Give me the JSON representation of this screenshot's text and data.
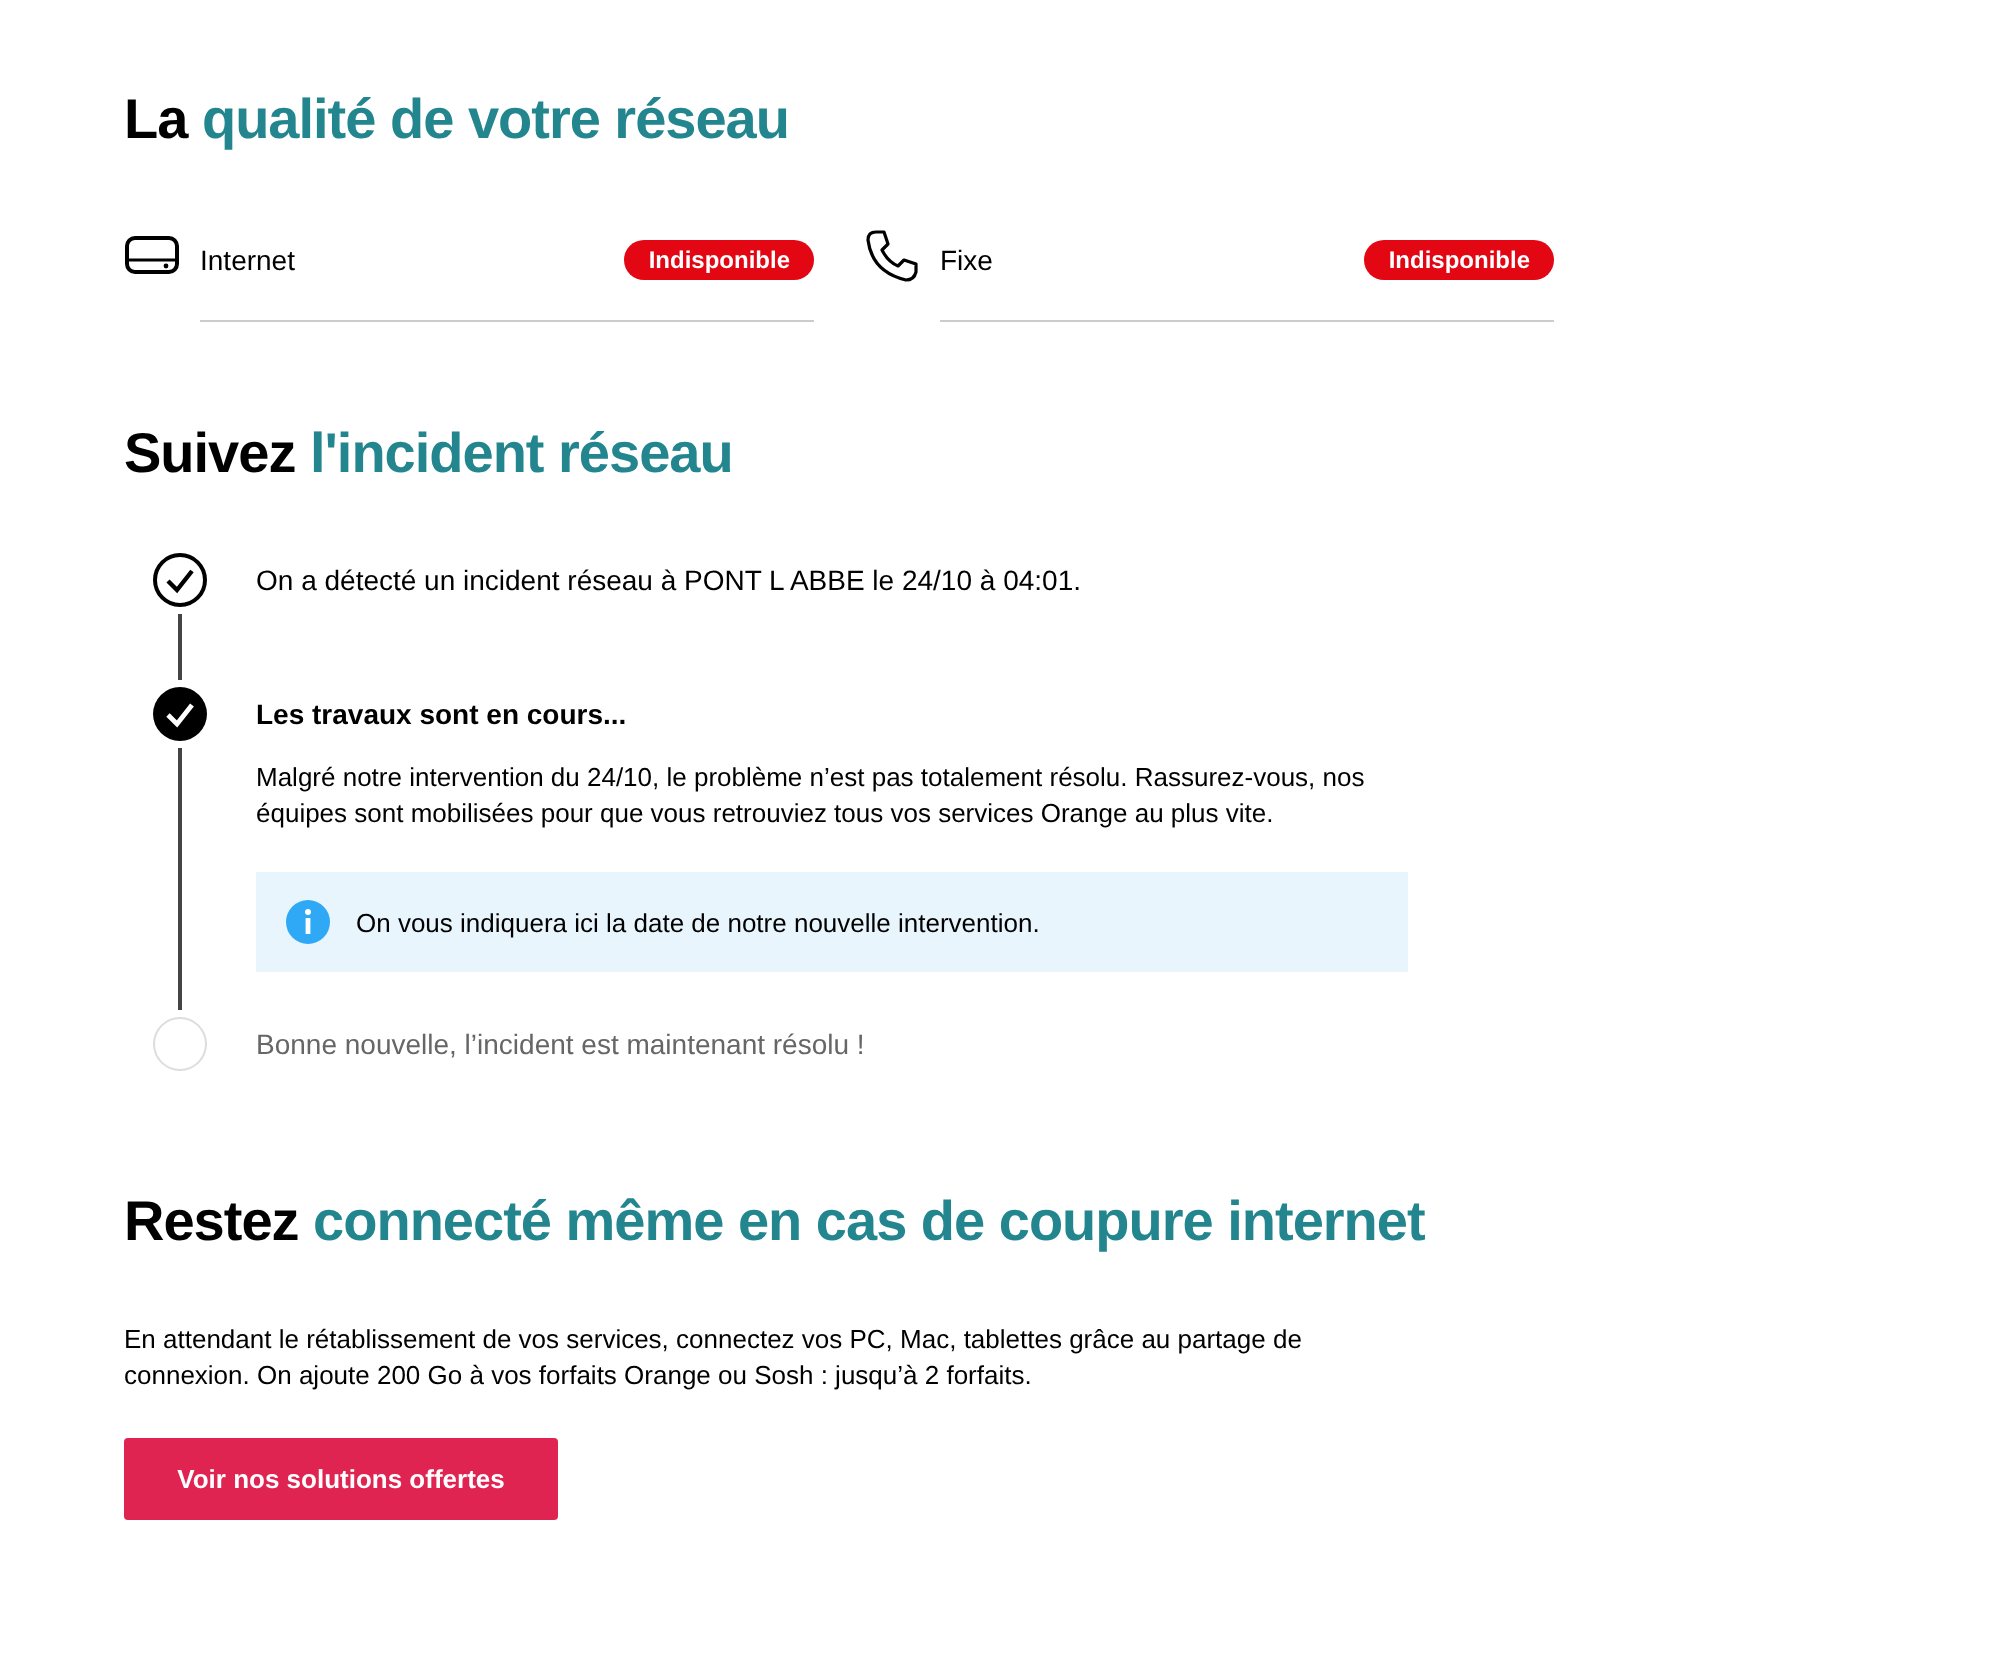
{
  "quality": {
    "title": {
      "lead": "La",
      "accent": "qualité de votre réseau"
    },
    "services": [
      {
        "kind": "internet",
        "label": "Internet",
        "status": "Indisponible"
      },
      {
        "kind": "phone",
        "label": "Fixe",
        "status": "Indisponible"
      }
    ]
  },
  "incident": {
    "title": {
      "lead": "Suivez",
      "accent": "l'incident réseau"
    },
    "steps": [
      {
        "kind": "done",
        "title": "On a détecté un incident réseau à PONT L ABBE le 24/10 à 04:01."
      },
      {
        "kind": "current",
        "title": "Les travaux sont en cours...",
        "text": "Malgré notre intervention du 24/10, le problème n’est pas totalement résolu. Rassurez-vous, nos équipes sont mobilisées pour que vous retrouviez tous vos services Orange au plus vite.",
        "info": "On vous indiquera ici la date de notre nouvelle intervention."
      },
      {
        "kind": "pending",
        "title": "Bonne nouvelle, l’incident est maintenant résolu !"
      }
    ]
  },
  "connected": {
    "title": {
      "lead": "Restez",
      "accent": "connecté même en cas de coupure internet"
    },
    "text": "En attendant le rétablissement de vos services, connectez vos PC, Mac, tablettes grâce au partage de connexion. On ajoute 200 Go à vos forfaits Orange ou Sosh : jusqu’à 2 forfaits.",
    "button": "Voir nos solutions offertes"
  }
}
